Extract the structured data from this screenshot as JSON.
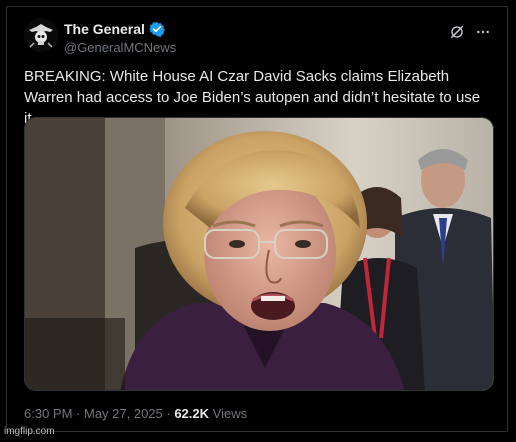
{
  "author": {
    "display_name": "The General",
    "handle": "@GeneralMCNews",
    "verified": true
  },
  "tweet": {
    "text": "BREAKING: White House AI Czar David Sacks claims Elizabeth Warren had access to Joe Biden’s autopen and didn’t hesitate to use it."
  },
  "meta": {
    "time": "6:30 PM",
    "separator1": " · ",
    "date": "May 27, 2025",
    "separator2": " · ",
    "views_count": "62.2K",
    "views_label": " Views"
  },
  "icons": {
    "verified": "verified-badge-icon",
    "grok": "grok-icon",
    "more": "more-icon"
  },
  "colors": {
    "background": "#000000",
    "text": "#e7e9ea",
    "muted": "#71767b",
    "verified": "#1d9bf0",
    "border": "#2f3336"
  },
  "watermark": "imgflip.com"
}
